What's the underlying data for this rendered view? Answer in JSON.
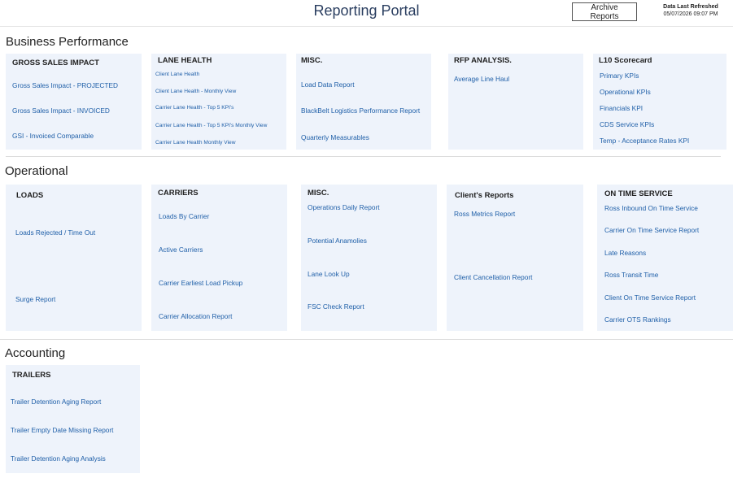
{
  "header": {
    "title": "Reporting Portal",
    "archive_label": "Archive Reports",
    "refresh_label": "Data Last Refreshed",
    "refresh_time": "05/07/2026 09:07 PM"
  },
  "sections": {
    "business": {
      "title": "Business Performance",
      "cards": [
        {
          "title": "GROSS SALES IMPACT",
          "links": [
            "Gross Sales Impact - PROJECTED",
            "Gross Sales Impact - INVOICED",
            "GSI - Invoiced Comparable"
          ]
        },
        {
          "title": "LANE HEALTH",
          "links": [
            "Client Lane Health",
            "Client Lane Health - Monthly View",
            "Carrier Lane Health - Top 5 KPI's",
            "Carrier Lane Health - Top 5 KPI's Monthly View",
            "Carrier Lane Health Monthly View"
          ]
        },
        {
          "title": "MISC.",
          "links": [
            "Load Data Report",
            "BlackBelt Logistics Performance Report",
            "Quarterly Measurables"
          ]
        },
        {
          "title": "RFP ANALYSIS.",
          "links": [
            "Average Line Haul"
          ]
        },
        {
          "title": "L10 Scorecard",
          "links": [
            "Primary KPIs",
            "Operational KPIs",
            "Financials KPI",
            "CDS Service KPIs",
            "Temp - Acceptance Rates KPI"
          ]
        }
      ]
    },
    "operational": {
      "title": "Operational",
      "cards": [
        {
          "title": "LOADS",
          "links": [
            "Loads Rejected / Time Out",
            "Surge Report"
          ]
        },
        {
          "title": "CARRIERS",
          "links": [
            "Loads By Carrier",
            "Active Carriers",
            "Carrier Earliest Load Pickup",
            "Carrier Allocation Report"
          ]
        },
        {
          "title": "MISC.",
          "links": [
            "Operations Daily Report",
            "Potential Anamolies",
            "Lane Look Up",
            "FSC Check Report"
          ]
        },
        {
          "title": "Client's Reports",
          "links": [
            "Ross Metrics Report",
            "Client Cancellation Report"
          ]
        },
        {
          "title": "ON TIME SERVICE",
          "links": [
            "Ross Inbound On Time Service",
            "Carrier On Time Service Report",
            "Late Reasons",
            "Ross Transit Time",
            "Client On Time Service Report",
            "Carrier OTS Rankings"
          ]
        }
      ]
    },
    "accounting": {
      "title": "Accounting",
      "cards": [
        {
          "title": "TRAILERS",
          "links": [
            "Trailer Detention Aging Report",
            "Trailer Empty Date Missing Report",
            "Trailer Detention Aging Analysis"
          ]
        }
      ]
    }
  },
  "colors": {
    "card_bg": "#eef3fb",
    "link": "#1f5fa8",
    "title": "#2a3e60"
  }
}
